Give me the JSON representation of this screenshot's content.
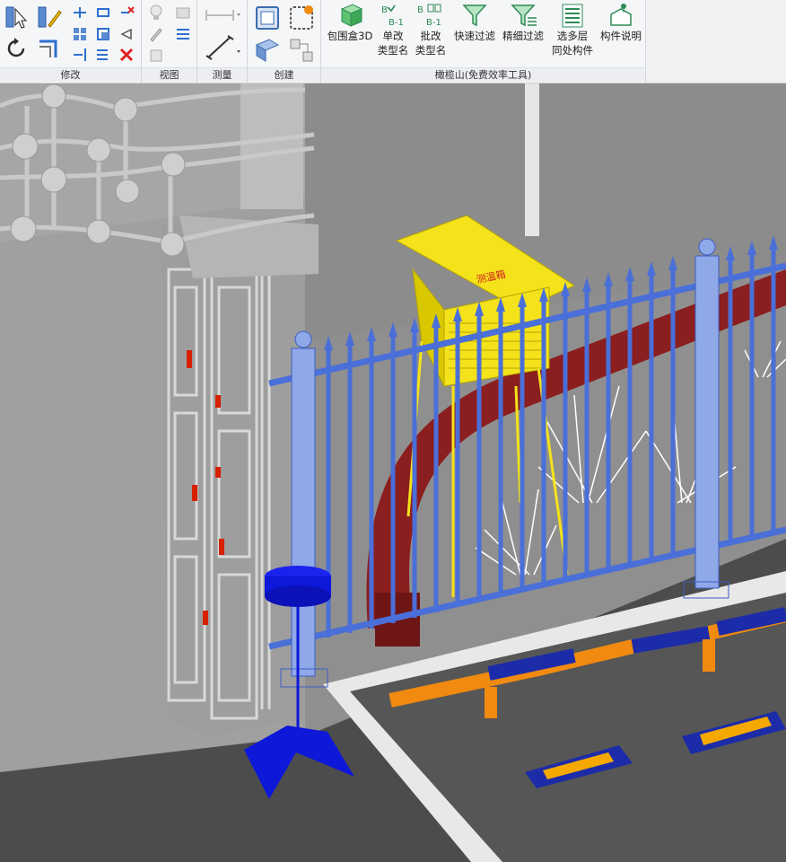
{
  "ribbon": {
    "panels": {
      "modify": "修改",
      "view": "视图",
      "measure": "测量",
      "create": "创建",
      "plugin": "橄榄山(免费效率工具)"
    },
    "tools": {
      "bbox3d": "包围盒3D",
      "rename_single_1": "单改",
      "rename_single_2": "类型名",
      "rename_batch_1": "批改",
      "rename_batch_2": "类型名",
      "quick_filter": "快速过滤",
      "fine_filter": "精细过滤",
      "multi_floor_1": "选多层",
      "multi_floor_2": "同处构件",
      "component_info": "构件说明",
      "rename_badge": "B-1"
    }
  },
  "scene": {
    "cabinet_label": "测温箱"
  },
  "colors": {
    "accent_green": "#2e8b57",
    "fence_blue": "#4a6fd8",
    "cabinet_yellow": "#f4e21b",
    "bench_red": "#8b1e1e",
    "barrier_orange": "#f08a10",
    "barrier_blue": "#1c2ca8"
  }
}
